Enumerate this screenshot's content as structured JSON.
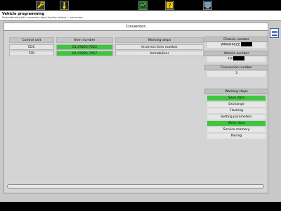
{
  "header": {
    "title": "Vehicle programming",
    "subtitle": "Parameterizing with conversion data (function status) = conversion"
  },
  "panel": {
    "title": "Conversion"
  },
  "table": {
    "headers": [
      "Control unit",
      "Item number",
      "Working steps"
    ],
    "rows": [
      {
        "unit": "EDC",
        "item": "01.29803-7022",
        "step": "Incorrect item number"
      },
      {
        "unit": "FFR",
        "item": "81.25805-7057",
        "step": "Immobiliser"
      }
    ]
  },
  "info": {
    "chassis_label": "Chassis number",
    "chassis_value": "WMAH06ZZ",
    "vehicle_label": "Vehicle number",
    "vehicle_value": "HX",
    "conversion_label": "Conversion number",
    "conversion_value": "3"
  },
  "steps": {
    "label": "Working steps",
    "items": [
      "Save data",
      "Exchange",
      "Flashing",
      "Setting parameters",
      "Write data",
      "Service memory",
      "Pairing"
    ]
  },
  "colors": {
    "highlight": "#3ec73e",
    "toolbar": "#000000"
  }
}
